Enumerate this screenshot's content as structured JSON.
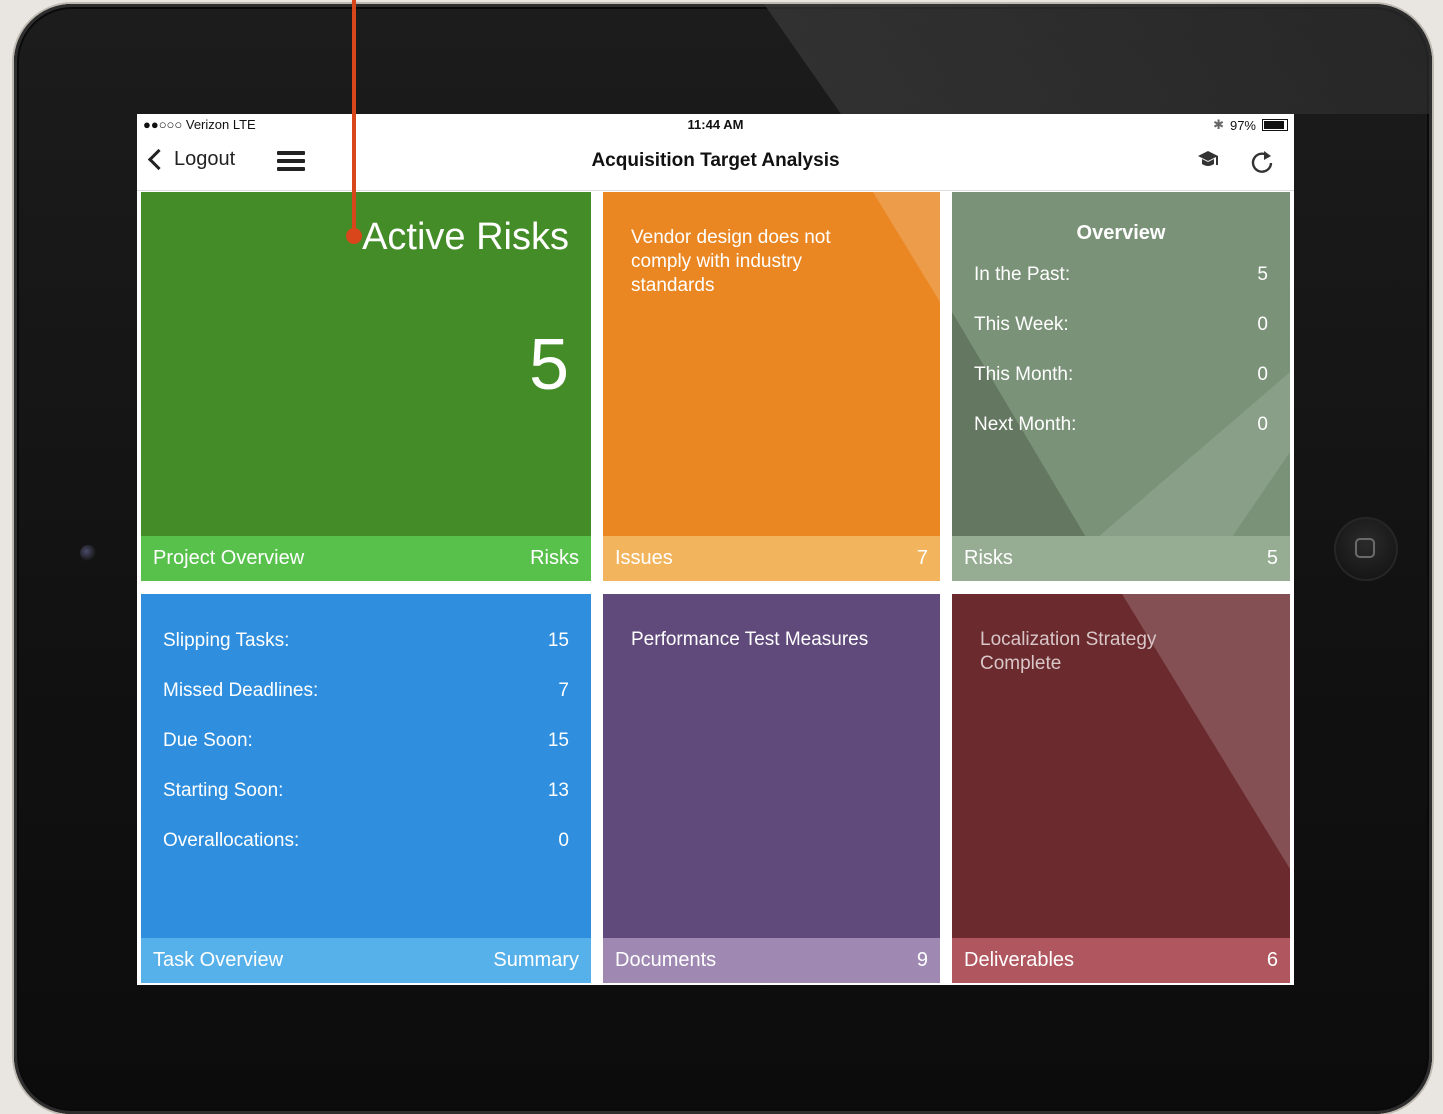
{
  "status_bar": {
    "carrier": "●●○○○ Verizon  LTE",
    "time": "11:44 AM",
    "bluetooth": "✱",
    "battery": "97%"
  },
  "nav": {
    "back_label": "Logout",
    "title": "Acquisition Target Analysis"
  },
  "tiles": {
    "project_overview": {
      "heading": "Active Risks",
      "value": "5",
      "footer_left": "Project Overview",
      "footer_right": "Risks",
      "color": "#438c28",
      "footer_color": "#58c14c"
    },
    "issues": {
      "text": "Vendor design does not comply with industry standards",
      "footer_left": "Issues",
      "footer_right": "7",
      "color": "#ea8723",
      "footer_color": "#f2b55e"
    },
    "risks": {
      "heading": "Overview",
      "rows": [
        {
          "label": "In the Past:",
          "value": "5"
        },
        {
          "label": "This Week:",
          "value": "0"
        },
        {
          "label": "This Month:",
          "value": "0"
        },
        {
          "label": "Next Month:",
          "value": "0"
        }
      ],
      "footer_left": "Risks",
      "footer_right": "5",
      "color": "#7a9277",
      "footer_color": "#96ad93"
    },
    "task_overview": {
      "rows": [
        {
          "label": "Slipping Tasks:",
          "value": "15"
        },
        {
          "label": "Missed Deadlines:",
          "value": "7"
        },
        {
          "label": "Due Soon:",
          "value": "15"
        },
        {
          "label": "Starting Soon:",
          "value": "13"
        },
        {
          "label": "Overallocations:",
          "value": "0"
        }
      ],
      "footer_left": "Task Overview",
      "footer_right": "Summary",
      "color": "#2f8fde",
      "footer_color": "#56b1ea"
    },
    "documents": {
      "text": "Performance Test Measures",
      "footer_left": "Documents",
      "footer_right": "9",
      "color": "#604a7b",
      "footer_color": "#9f88b2"
    },
    "deliverables": {
      "text": "Localization Strategy Complete",
      "footer_left": "Deliverables",
      "footer_right": "6",
      "color": "#6a2a2e",
      "footer_color": "#b0565e"
    }
  }
}
